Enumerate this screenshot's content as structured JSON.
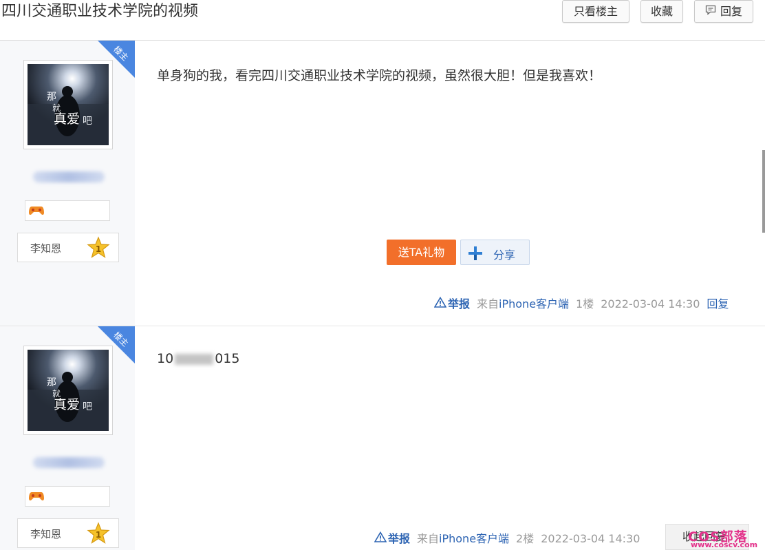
{
  "header": {
    "title": "四川交通职业技术学院的视频",
    "only_owner_label": "只看楼主",
    "favorite_label": "收藏",
    "reply_label": "回复"
  },
  "posts": [
    {
      "badge": "楼主",
      "avatar_text_1": "那",
      "avatar_text_2": "就",
      "avatar_text_3": "真爱",
      "avatar_text_4": "吧",
      "level_name": "李知恩",
      "level_num": "1",
      "content": "单身狗的我，看完四川交通职业技术学院的视频，虽然很大胆！但是我喜欢！",
      "gift_label": "送TA礼物",
      "share_label": "分享",
      "report_label": "举报",
      "source_prefix": "来自",
      "source_link": "iPhone客户端",
      "floor": "1楼",
      "time": "2022-03-04 14:30",
      "reply_label": "回复"
    },
    {
      "badge": "楼主",
      "avatar_text_1": "那",
      "avatar_text_2": "就",
      "avatar_text_3": "真爱",
      "avatar_text_4": "吧",
      "level_name": "李知恩",
      "level_num": "1",
      "content_prefix": "10",
      "content_suffix": "015",
      "report_label": "举报",
      "source_prefix": "来自",
      "source_link": "iPhone客户端",
      "floor": "2楼",
      "time": "2022-03-04 14:30",
      "collapse_label": "收起回复"
    }
  ],
  "watermark": {
    "text": "COS部落",
    "url": "www.coscv.com"
  },
  "colors": {
    "accent_blue": "#2d64b3",
    "gift_orange": "#f26f2a",
    "badge_blue": "#4a86e0"
  }
}
